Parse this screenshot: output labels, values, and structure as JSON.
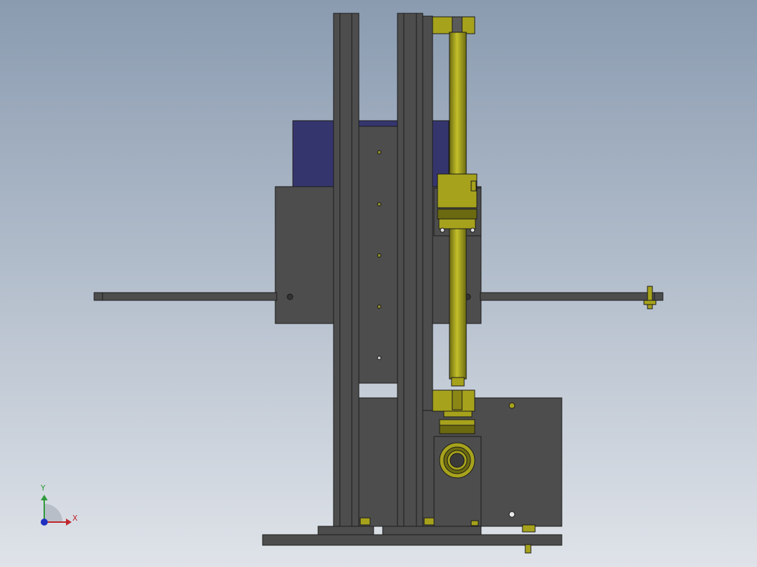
{
  "viewport": {
    "background_top": "#8a9bb0",
    "background_bottom": "#dfe3e9"
  },
  "colors": {
    "frame_gray": "#4d4d4d",
    "frame_edge": "#1a1a1a",
    "motor_blue": "#35356e",
    "cylinder_olive": "#a6a21c",
    "cylinder_dark": "#6b6a10",
    "axis_x": "#c0262c",
    "axis_y": "#2e9a3a",
    "axis_z": "#2030c0"
  },
  "triad": {
    "x_label": "X",
    "y_label": "Y"
  }
}
